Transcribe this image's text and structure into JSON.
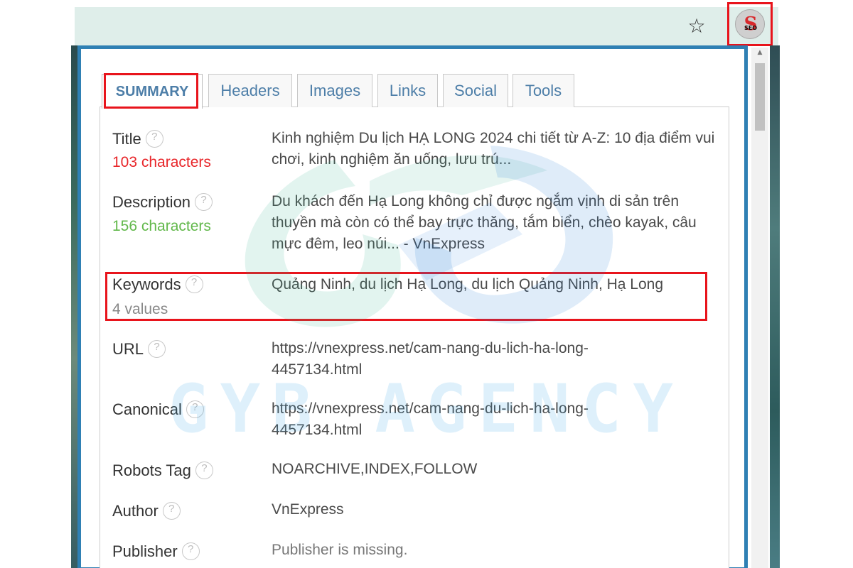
{
  "toolbar": {
    "star_icon": "star-icon",
    "extension": {
      "letter": "S",
      "small_text": "SEO"
    }
  },
  "tabs": [
    {
      "label": "SUMMARY"
    },
    {
      "label": "Headers"
    },
    {
      "label": "Images"
    },
    {
      "label": "Links"
    },
    {
      "label": "Social"
    },
    {
      "label": "Tools"
    }
  ],
  "rows": {
    "title": {
      "label": "Title",
      "count": "103 characters",
      "value": "Kinh nghiệm Du lịch HẠ LONG 2024 chi tiết từ A-Z: 10 địa điểm vui chơi, kinh nghiệm ăn uống, lưu trú..."
    },
    "description": {
      "label": "Description",
      "count": "156 characters",
      "value": "Du khách đến Hạ Long không chỉ được ngắm vịnh di sản trên thuyền mà còn có thể bay trực thăng, tắm biển, chèo kayak, câu mực đêm, leo núi... - VnExpress"
    },
    "keywords": {
      "label": "Keywords",
      "count": "4 values",
      "value": "Quảng Ninh, du lịch Hạ Long, du lịch Quảng Ninh, Hạ Long"
    },
    "url": {
      "label": "URL",
      "value": "https://vnexpress.net/cam-nang-du-lich-ha-long-4457134.html"
    },
    "canonical": {
      "label": "Canonical",
      "value": "https://vnexpress.net/cam-nang-du-lich-ha-long-4457134.html"
    },
    "robots": {
      "label": "Robots Tag",
      "value": "NOARCHIVE,INDEX,FOLLOW"
    },
    "author": {
      "label": "Author",
      "value": "VnExpress"
    },
    "publisher": {
      "label": "Publisher",
      "value": "Publisher is missing."
    }
  },
  "help_glyph": "?",
  "watermark": {
    "text": "GYB AGENCY"
  },
  "colors": {
    "accent": "#2f80b4",
    "highlight": "#e8141c",
    "count_bad": "#e8262a",
    "count_good": "#62b84b",
    "count_neutral": "#888888",
    "tab_text": "#4d7ea8"
  }
}
